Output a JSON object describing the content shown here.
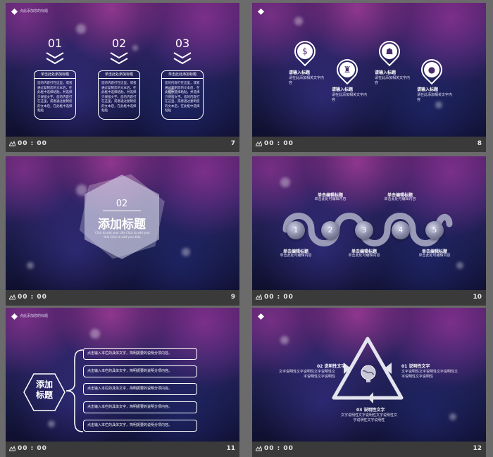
{
  "footer": {
    "time": "00 : 00"
  },
  "slides": [
    {
      "number": "7",
      "header": "点此添加您的标题",
      "columns": [
        {
          "num": "01",
          "tag": "单击此处添加标题",
          "body": "您的内容打在这里，或者通过复制您的文本后，在此框中选择粘贴，并选择只保留文字。您的内容打在这里，或者通过复制您的文本后，在此框中选择粘贴"
        },
        {
          "num": "02",
          "tag": "单击此处添加标题",
          "body": "您的内容打在这里，或者通过复制您的文本后，在此框中选择粘贴，并选择只保留文字。您的内容打在这里，或者通过复制您的文本后，在此框中选择粘贴"
        },
        {
          "num": "03",
          "tag": "单击此处添加标题",
          "body": "您的内容打在这里，或者通过复制您的文本后，在此框中选择粘贴，并选择只保留文字。您的内容打在这里，或者通过复制您的文本后，在此框中选择粘贴"
        }
      ]
    },
    {
      "number": "8",
      "header": "",
      "items": [
        {
          "icon": "dollar-person-icon",
          "glyph": "$",
          "title": "请输入标题",
          "text": "请在此添加相关文字内容"
        },
        {
          "icon": "presenter-icon",
          "glyph": "♜",
          "title": "请输入标题",
          "text": "请在此添加相关文字内容"
        },
        {
          "icon": "team-icon",
          "glyph": "☗",
          "title": "请输入标题",
          "text": "请在此添加相关文字内容"
        },
        {
          "icon": "user-icon",
          "glyph": "●",
          "title": "请输入标题",
          "text": "请在此添加相关文字内容"
        }
      ]
    },
    {
      "number": "9",
      "header": "",
      "section_num": "02",
      "section_title": "添加标题",
      "section_sub": "Click to add your title Click to add your title Click to add your title."
    },
    {
      "number": "10",
      "header": "",
      "steps": [
        "1",
        "2",
        "3",
        "4",
        "5"
      ],
      "captions_top": [
        {
          "title": "单击编辑标题",
          "text": "单击此处可编辑内容"
        },
        {
          "title": "单击编辑标题",
          "text": "单击此处可编辑内容"
        }
      ],
      "captions_bottom": [
        {
          "title": "单击编辑标题",
          "text": "单击此处可编辑内容"
        },
        {
          "title": "单击编辑标题",
          "text": "单击此处可编辑内容"
        },
        {
          "title": "单击编辑标题",
          "text": "单击此处可编辑内容"
        }
      ]
    },
    {
      "number": "11",
      "header": "点此添加您的标题",
      "hex_title": "添加\n标题",
      "pills": [
        "点击输入本栏的具体文字，简明扼要的说明分项内容。",
        "点击输入本栏的具体文字，简明扼要的说明分项内容。",
        "点击输入本栏的具体文字，简明扼要的说明分项内容。",
        "点击输入本栏的具体文字，简明扼要的说明分项内容。",
        "点击输入本栏的具体文字，简明扼要的说明分项内容。"
      ]
    },
    {
      "number": "12",
      "header": "",
      "labels": [
        {
          "title": "02 说明性文字",
          "text": "文字说明性文字说明性文字说明性文字说明性文字说明性"
        },
        {
          "title": "01 说明性文字",
          "text": "文字说明性文字说明性文字说明性文字说明性文字说明性"
        },
        {
          "title": "03 说明性文字",
          "text": "文字说明性文字说明性文字说明性文字说明性文字说明性"
        }
      ]
    }
  ]
}
